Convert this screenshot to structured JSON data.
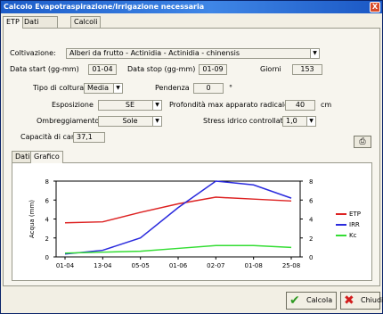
{
  "window": {
    "title": "Calcolo Evapotraspirazione/Irrigazione necessaria",
    "close_label": "X"
  },
  "tabs_top": [
    {
      "label": "ETP"
    },
    {
      "label": "Dati progetto"
    },
    {
      "label": "Calcoli"
    }
  ],
  "form": {
    "coltivazione_label": "Coltivazione:",
    "coltivazione_value": "Alberi da frutto - Actinidia - Actinidia - chinensis",
    "data_start_label": "Data start (gg-mm)",
    "data_start_value": "01-04",
    "data_stop_label": "Data stop (gg-mm)",
    "data_stop_value": "01-09",
    "giorni_label": "Giorni",
    "giorni_value": "153",
    "tipo_coltura_label": "Tipo di coltura",
    "tipo_coltura_value": "Media",
    "pendenza_label": "Pendenza",
    "pendenza_value": "0",
    "pendenza_unit": "°",
    "esposizione_label": "Esposizione",
    "esposizione_value": "SE",
    "profondita_label": "Profondità max apparato radicale",
    "profondita_value": "40",
    "profondita_unit": "cm",
    "ombreggiamento_label": "Ombreggiamento",
    "ombreggiamento_value": "Sole",
    "stress_label": "Stress idrico controllato",
    "stress_value": "1,0",
    "capacita_label": "Capacità di campo",
    "capacita_value": "37,1"
  },
  "tabs_inner": [
    {
      "label": "Dati"
    },
    {
      "label": "Grafico"
    }
  ],
  "buttons": {
    "calcola": "Calcola",
    "chiudi": "Chiudi"
  },
  "colors": {
    "etp": "#dd2222",
    "irr": "#2a2add",
    "kc": "#33dd33"
  },
  "chart_data": {
    "type": "line",
    "categories": [
      "01-04",
      "13-04",
      "05-05",
      "01-06",
      "02-07",
      "01-08",
      "25-08"
    ],
    "ylabel": "Acqua (mm)",
    "ylim": [
      0,
      8
    ],
    "yticks": [
      "0",
      "2",
      "4",
      "6",
      "8"
    ],
    "y2lim": [
      0,
      8
    ],
    "y2ticks": [
      "0",
      "2",
      "4",
      "6",
      "8"
    ],
    "legend_position": "right",
    "series": [
      {
        "name": "ETP",
        "values": [
          3.6,
          3.7,
          4.7,
          5.6,
          6.3,
          6.1,
          5.9
        ]
      },
      {
        "name": "IRR",
        "values": [
          0.3,
          0.7,
          2.0,
          5.2,
          8.0,
          7.6,
          6.2
        ]
      },
      {
        "name": "Kc",
        "values": [
          0.4,
          0.5,
          0.6,
          0.9,
          1.2,
          1.2,
          1.0
        ]
      }
    ]
  }
}
